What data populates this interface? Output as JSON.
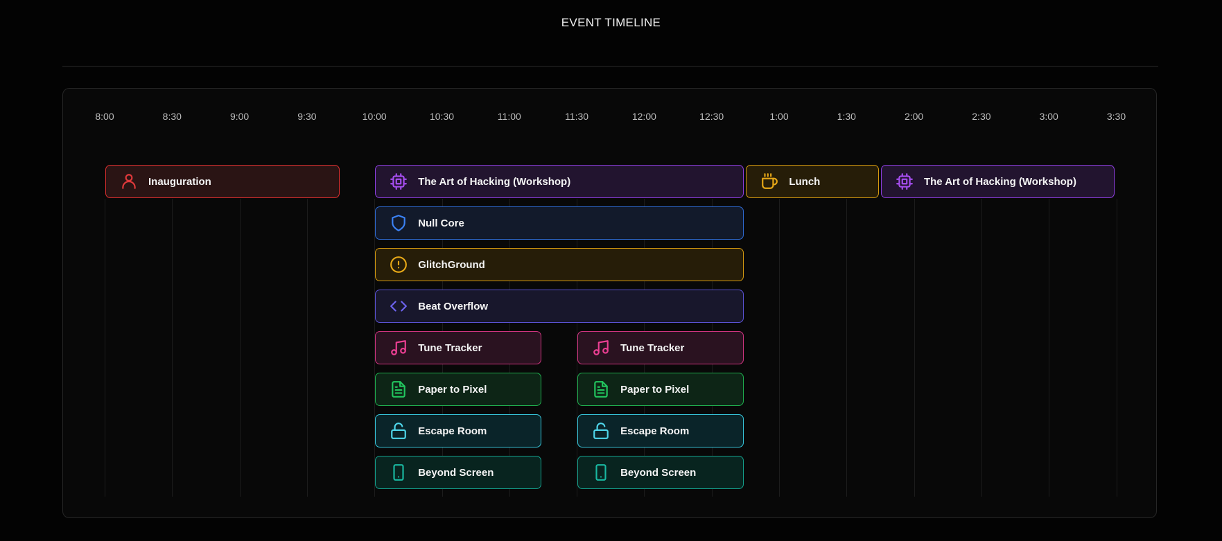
{
  "page": {
    "title": "EVENT TIMELINE"
  },
  "timeline": {
    "time_labels": [
      "8:00",
      "8:30",
      "9:00",
      "9:30",
      "10:00",
      "10:30",
      "11:00",
      "11:30",
      "12:00",
      "12:30",
      "1:00",
      "1:30",
      "2:00",
      "2:30",
      "3:00",
      "3:30"
    ],
    "events": [
      {
        "name": "Inauguration",
        "start": "8:00",
        "end": "9:45",
        "row": 1,
        "color": "red",
        "icon": "user-icon"
      },
      {
        "name": "The Art of Hacking (Workshop)",
        "start": "10:00",
        "end": "12:45",
        "row": 1,
        "color": "purple",
        "icon": "cpu-icon"
      },
      {
        "name": "Lunch",
        "start": "12:45",
        "end": "1:45",
        "row": 1,
        "color": "amber",
        "icon": "coffee-icon"
      },
      {
        "name": "The Art of Hacking (Workshop)",
        "start": "1:45",
        "end": "3:30",
        "row": 1,
        "color": "purple",
        "icon": "cpu-icon"
      },
      {
        "name": "Null Core",
        "start": "10:00",
        "end": "12:45",
        "row": 2,
        "color": "blue",
        "icon": "shield-icon"
      },
      {
        "name": "GlitchGround",
        "start": "10:00",
        "end": "12:45",
        "row": 3,
        "color": "amber",
        "icon": "alert-circle-icon"
      },
      {
        "name": "Beat Overflow",
        "start": "10:00",
        "end": "12:45",
        "row": 4,
        "color": "indigo",
        "icon": "code-icon"
      },
      {
        "name": "Tune Tracker",
        "start": "10:00",
        "end": "11:15",
        "row": 5,
        "color": "pink",
        "icon": "music-icon"
      },
      {
        "name": "Tune Tracker",
        "start": "11:30",
        "end": "12:45",
        "row": 5,
        "color": "pink",
        "icon": "music-icon"
      },
      {
        "name": "Paper to Pixel",
        "start": "10:00",
        "end": "11:15",
        "row": 6,
        "color": "green",
        "icon": "file-text-icon"
      },
      {
        "name": "Paper to Pixel",
        "start": "11:30",
        "end": "12:45",
        "row": 6,
        "color": "green",
        "icon": "file-text-icon"
      },
      {
        "name": "Escape Room",
        "start": "10:00",
        "end": "11:15",
        "row": 7,
        "color": "cyan",
        "icon": "unlock-icon"
      },
      {
        "name": "Escape Room",
        "start": "11:30",
        "end": "12:45",
        "row": 7,
        "color": "cyan",
        "icon": "unlock-icon"
      },
      {
        "name": "Beyond Screen",
        "start": "10:00",
        "end": "11:15",
        "row": 8,
        "color": "teal",
        "icon": "smartphone-icon"
      },
      {
        "name": "Beyond Screen",
        "start": "11:30",
        "end": "12:45",
        "row": 8,
        "color": "teal",
        "icon": "smartphone-icon"
      }
    ]
  }
}
